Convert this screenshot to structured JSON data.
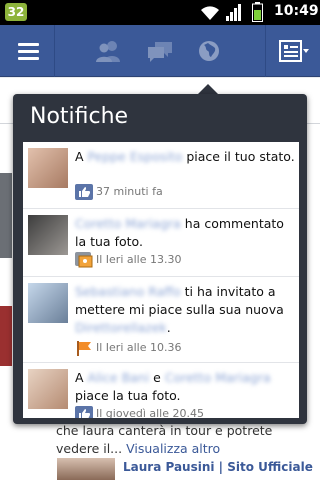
{
  "status_bar": {
    "badge": "32",
    "time": "10:49",
    "icons": [
      "wifi-icon",
      "signal-icon",
      "battery-icon"
    ]
  },
  "top_bar": {
    "color": "#3b5998",
    "icons": [
      "menu-icon",
      "friend-requests-icon",
      "messages-icon",
      "notifications-globe-icon",
      "pages-menu-icon"
    ]
  },
  "notifications": {
    "title": "Notifiche",
    "items": [
      {
        "actor_1": "Peppe Esposito",
        "prefix": "A ",
        "text": " piace il tuo stato.",
        "time": "37 minuti fa",
        "icon": "like-icon"
      },
      {
        "actor_1": "Coretto Mariagra",
        "text": " ha commentato la tua foto.",
        "time": "Il Ieri alle 13.30",
        "icon": "comment-photo-icon"
      },
      {
        "actor_1": "Sebastiano Raffo",
        "text_1": " ti ha invitato a mettere mi piace sulla sua nuova ",
        "actor_2": "Direttorellazek",
        "text_2": ".",
        "time": "Il Ieri alle 10.36",
        "icon": "flag-icon"
      },
      {
        "prefix": "A ",
        "actor_1": "Alice Bani",
        "conj": " e ",
        "actor_2": "Coretto Mariagra",
        "text": " piace la tua foto.",
        "time": "Il giovedì alle 20.45",
        "icon": "like-icon"
      }
    ]
  },
  "feed": {
    "post_text": "che laura canterà in tour e potrete vedere il...",
    "more_link": "Visualizza altro",
    "page_name": "Laura Pausini | Sito Ufficiale"
  }
}
